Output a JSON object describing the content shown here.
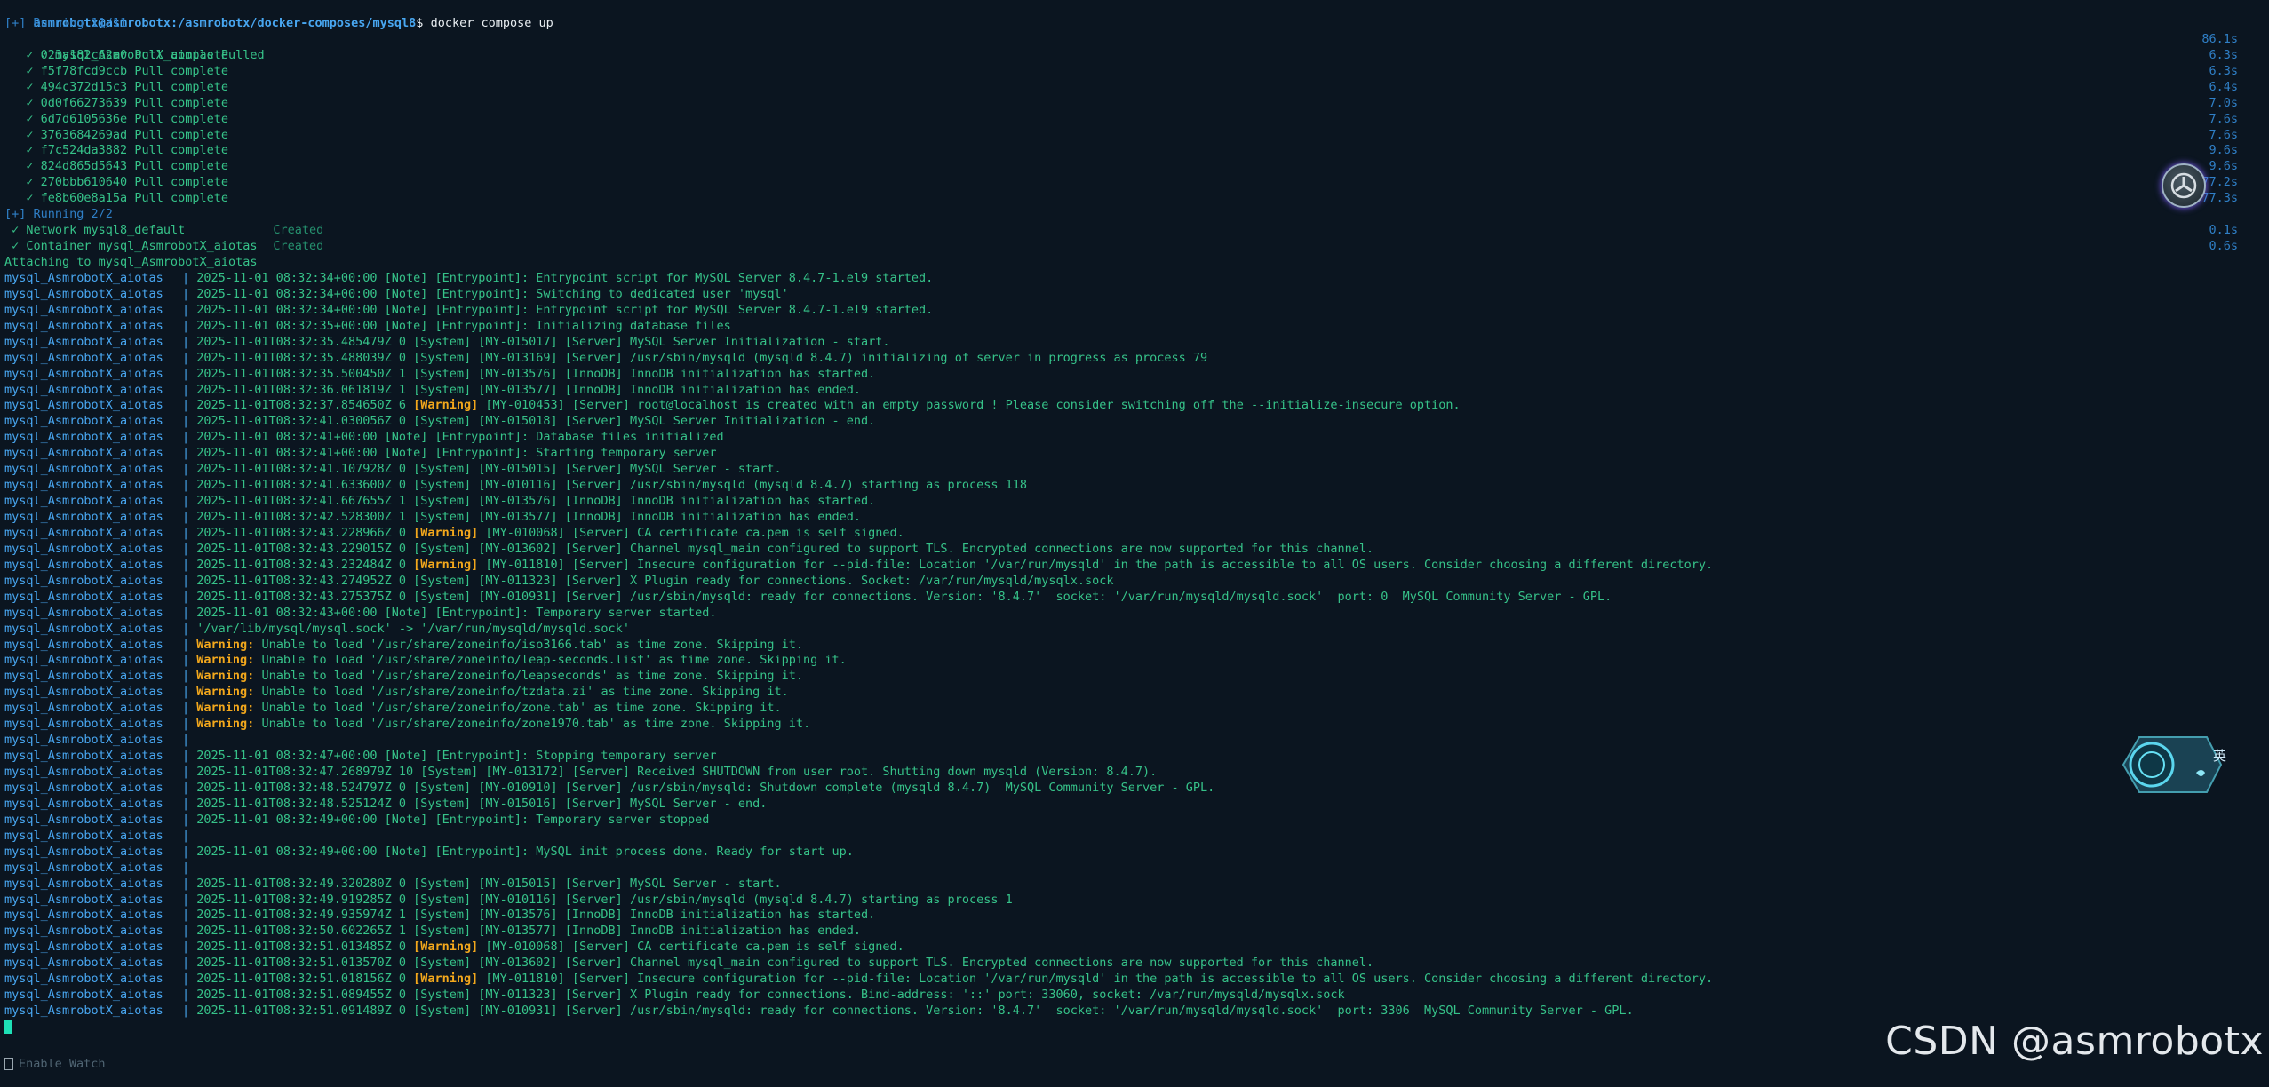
{
  "prompt": {
    "user_host": "asmrobotx@asmrobotx",
    "path": ":/asmrobotx/docker-composes/mysql8",
    "symbol": "$",
    "command": "docker compose up"
  },
  "pull_section": {
    "header": "[+] Running 11/11",
    "main": {
      "label": "mysql_AsmrobotX_aiotas Pulled",
      "time": "86.1s"
    },
    "layers": [
      {
        "id": "023a182c62a0",
        "status": "Pull complete",
        "time": "6.3s"
      },
      {
        "id": "f5f78fcd9ccb",
        "status": "Pull complete",
        "time": "6.3s"
      },
      {
        "id": "494c372d15c3",
        "status": "Pull complete",
        "time": "6.4s"
      },
      {
        "id": "0d0f66273639",
        "status": "Pull complete",
        "time": "7.0s"
      },
      {
        "id": "6d7d6105636e",
        "status": "Pull complete",
        "time": "7.6s"
      },
      {
        "id": "3763684269ad",
        "status": "Pull complete",
        "time": "7.6s"
      },
      {
        "id": "f7c524da3882",
        "status": "Pull complete",
        "time": "9.6s"
      },
      {
        "id": "824d865d5643",
        "status": "Pull complete",
        "time": "9.6s"
      },
      {
        "id": "270bbb610640",
        "status": "Pull complete",
        "time": "77.2s"
      },
      {
        "id": "fe8b60e8a15a",
        "status": "Pull complete",
        "time": "77.3s"
      }
    ]
  },
  "create_section": {
    "header": "[+] Running 2/2",
    "items": [
      {
        "label": "Network mysql8_default",
        "status": "Created",
        "time": "0.1s"
      },
      {
        "label": "Container mysql_AsmrobotX_aiotas",
        "status": "Created",
        "time": "0.6s"
      }
    ]
  },
  "attach_line": "Attaching to mysql_AsmrobotX_aiotas",
  "service_name": "mysql_AsmrobotX_aiotas",
  "separator": "|",
  "log_lines": [
    {
      "text": "2025-11-01 08:32:34+00:00 [Note] [Entrypoint]: Entrypoint script for MySQL Server 8.4.7-1.el9 started."
    },
    {
      "text": "2025-11-01 08:32:34+00:00 [Note] [Entrypoint]: Switching to dedicated user 'mysql'"
    },
    {
      "text": "2025-11-01 08:32:34+00:00 [Note] [Entrypoint]: Entrypoint script for MySQL Server 8.4.7-1.el9 started."
    },
    {
      "text": "2025-11-01 08:32:35+00:00 [Note] [Entrypoint]: Initializing database files"
    },
    {
      "text": "2025-11-01T08:32:35.485479Z 0 [System] [MY-015017] [Server] MySQL Server Initialization - start."
    },
    {
      "text": "2025-11-01T08:32:35.488039Z 0 [System] [MY-013169] [Server] /usr/sbin/mysqld (mysqld 8.4.7) initializing of server in progress as process 79"
    },
    {
      "text": "2025-11-01T08:32:35.500450Z 1 [System] [MY-013576] [InnoDB] InnoDB initialization has started."
    },
    {
      "text": "2025-11-01T08:32:36.061819Z 1 [System] [MY-013577] [InnoDB] InnoDB initialization has ended."
    },
    {
      "pre": "2025-11-01T08:32:37.854650Z 6 ",
      "warn": "[Warning]",
      "post": " [MY-010453] [Server] root@localhost is created with an empty password ! Please consider switching off the --initialize-insecure option."
    },
    {
      "text": "2025-11-01T08:32:41.030056Z 0 [System] [MY-015018] [Server] MySQL Server Initialization - end."
    },
    {
      "text": "2025-11-01 08:32:41+00:00 [Note] [Entrypoint]: Database files initialized"
    },
    {
      "text": "2025-11-01 08:32:41+00:00 [Note] [Entrypoint]: Starting temporary server"
    },
    {
      "text": "2025-11-01T08:32:41.107928Z 0 [System] [MY-015015] [Server] MySQL Server - start."
    },
    {
      "text": "2025-11-01T08:32:41.633600Z 0 [System] [MY-010116] [Server] /usr/sbin/mysqld (mysqld 8.4.7) starting as process 118"
    },
    {
      "text": "2025-11-01T08:32:41.667655Z 1 [System] [MY-013576] [InnoDB] InnoDB initialization has started."
    },
    {
      "text": "2025-11-01T08:32:42.528300Z 1 [System] [MY-013577] [InnoDB] InnoDB initialization has ended."
    },
    {
      "pre": "2025-11-01T08:32:43.228966Z 0 ",
      "warn": "[Warning]",
      "post": " [MY-010068] [Server] CA certificate ca.pem is self signed."
    },
    {
      "text": "2025-11-01T08:32:43.229015Z 0 [System] [MY-013602] [Server] Channel mysql_main configured to support TLS. Encrypted connections are now supported for this channel."
    },
    {
      "pre": "2025-11-01T08:32:43.232484Z 0 ",
      "warn": "[Warning]",
      "post": " [MY-011810] [Server] Insecure configuration for --pid-file: Location '/var/run/mysqld' in the path is accessible to all OS users. Consider choosing a different directory."
    },
    {
      "text": "2025-11-01T08:32:43.274952Z 0 [System] [MY-011323] [Server] X Plugin ready for connections. Socket: /var/run/mysqld/mysqlx.sock"
    },
    {
      "text": "2025-11-01T08:32:43.275375Z 0 [System] [MY-010931] [Server] /usr/sbin/mysqld: ready for connections. Version: '8.4.7'  socket: '/var/run/mysqld/mysqld.sock'  port: 0  MySQL Community Server - GPL."
    },
    {
      "text": "2025-11-01 08:32:43+00:00 [Note] [Entrypoint]: Temporary server started."
    },
    {
      "text": "'/var/lib/mysql/mysql.sock' -> '/var/run/mysqld/mysqld.sock'"
    },
    {
      "warn": "Warning:",
      "post": " Unable to load '/usr/share/zoneinfo/iso3166.tab' as time zone. Skipping it."
    },
    {
      "warn": "Warning:",
      "post": " Unable to load '/usr/share/zoneinfo/leap-seconds.list' as time zone. Skipping it."
    },
    {
      "warn": "Warning:",
      "post": " Unable to load '/usr/share/zoneinfo/leapseconds' as time zone. Skipping it."
    },
    {
      "warn": "Warning:",
      "post": " Unable to load '/usr/share/zoneinfo/tzdata.zi' as time zone. Skipping it."
    },
    {
      "warn": "Warning:",
      "post": " Unable to load '/usr/share/zoneinfo/zone.tab' as time zone. Skipping it."
    },
    {
      "warn": "Warning:",
      "post": " Unable to load '/usr/share/zoneinfo/zone1970.tab' as time zone. Skipping it."
    },
    {
      "text": ""
    },
    {
      "text": "2025-11-01 08:32:47+00:00 [Note] [Entrypoint]: Stopping temporary server"
    },
    {
      "text": "2025-11-01T08:32:47.268979Z 10 [System] [MY-013172] [Server] Received SHUTDOWN from user root. Shutting down mysqld (Version: 8.4.7)."
    },
    {
      "text": "2025-11-01T08:32:48.524797Z 0 [System] [MY-010910] [Server] /usr/sbin/mysqld: Shutdown complete (mysqld 8.4.7)  MySQL Community Server - GPL."
    },
    {
      "text": "2025-11-01T08:32:48.525124Z 0 [System] [MY-015016] [Server] MySQL Server - end."
    },
    {
      "text": "2025-11-01 08:32:49+00:00 [Note] [Entrypoint]: Temporary server stopped"
    },
    {
      "text": ""
    },
    {
      "text": "2025-11-01 08:32:49+00:00 [Note] [Entrypoint]: MySQL init process done. Ready for start up."
    },
    {
      "text": ""
    },
    {
      "text": "2025-11-01T08:32:49.320280Z 0 [System] [MY-015015] [Server] MySQL Server - start."
    },
    {
      "text": "2025-11-01T08:32:49.919285Z 0 [System] [MY-010116] [Server] /usr/sbin/mysqld (mysqld 8.4.7) starting as process 1"
    },
    {
      "text": "2025-11-01T08:32:49.935974Z 1 [System] [MY-013576] [InnoDB] InnoDB initialization has started."
    },
    {
      "text": "2025-11-01T08:32:50.602265Z 1 [System] [MY-013577] [InnoDB] InnoDB initialization has ended."
    },
    {
      "pre": "2025-11-01T08:32:51.013485Z 0 ",
      "warn": "[Warning]",
      "post": " [MY-010068] [Server] CA certificate ca.pem is self signed."
    },
    {
      "text": "2025-11-01T08:32:51.013570Z 0 [System] [MY-013602] [Server] Channel mysql_main configured to support TLS. Encrypted connections are now supported for this channel."
    },
    {
      "pre": "2025-11-01T08:32:51.018156Z 0 ",
      "warn": "[Warning]",
      "post": " [MY-011810] [Server] Insecure configuration for --pid-file: Location '/var/run/mysqld' in the path is accessible to all OS users. Consider choosing a different directory."
    },
    {
      "text": "2025-11-01T08:32:51.089455Z 0 [System] [MY-011323] [Server] X Plugin ready for connections. Bind-address: '::' port: 33060, socket: /var/run/mysqld/mysqlx.sock"
    },
    {
      "text": "2025-11-01T08:32:51.091489Z 0 [System] [MY-010931] [Server] /usr/sbin/mysqld: ready for connections. Version: '8.4.7'  socket: '/var/run/mysqld/mysqld.sock'  port: 3306  MySQL Community Server - GPL."
    }
  ],
  "footer": {
    "watch_label": "Enable Watch",
    "watch_key": "w"
  },
  "watermark": "CSDN @asmrobotx",
  "ime": {
    "label": "英"
  },
  "colors": {
    "background": "#0b1520",
    "green": "#36c289",
    "blue": "#48a6f0",
    "warning": "#f3a81c"
  },
  "icons": {
    "check": "check-icon",
    "floating_assistant": "assistant-avatar-icon",
    "ime": "ime-indicator-icon"
  }
}
